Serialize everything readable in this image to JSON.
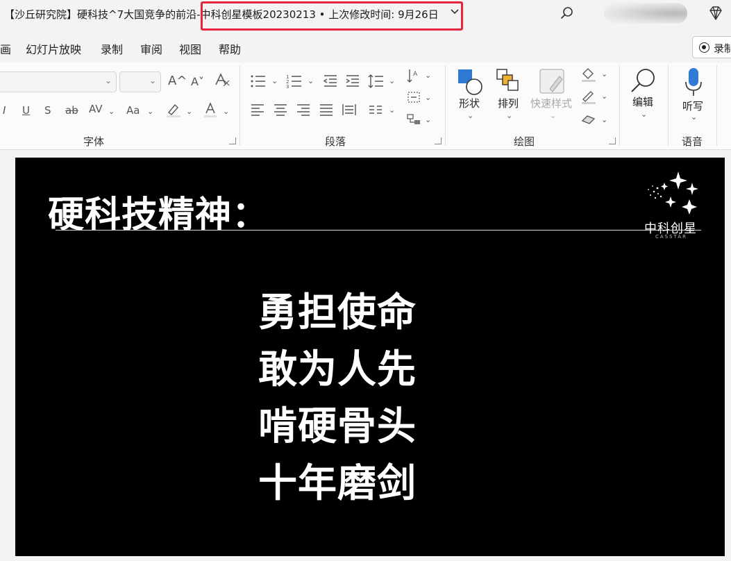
{
  "window": {
    "title_part1": "【沙丘研究院】硬科技^7大国竞争的前沿",
    "title_part2": "-中科创星模板20230213 • 上次修改时间: 9月26日"
  },
  "tabs": [
    "画",
    "幻灯片放映",
    "录制",
    "审阅",
    "视图",
    "帮助"
  ],
  "record_button": "录制",
  "ribbon": {
    "groups": {
      "font": "字体",
      "paragraph": "段落",
      "drawing": "绘图",
      "voice": "语音"
    },
    "font_row1": {
      "grow": "A^",
      "shrink": "A˅"
    },
    "font_row2": {
      "italic": "I",
      "underline": "U",
      "shadow": "S",
      "strike": "ab",
      "spacing": "AV",
      "case": "Aa"
    },
    "shape_label": "形状",
    "arrange_label": "排列",
    "quick_styles_label": "快速样式",
    "edit_label": "编辑",
    "dictate_label": "听写"
  },
  "slide": {
    "title": "硬科技精神：",
    "lines": [
      "勇担使命",
      "敢为人先",
      "啃硬骨头",
      "十年磨剑"
    ],
    "logo_cn": "中科创星",
    "logo_en": "CASSTAR"
  }
}
